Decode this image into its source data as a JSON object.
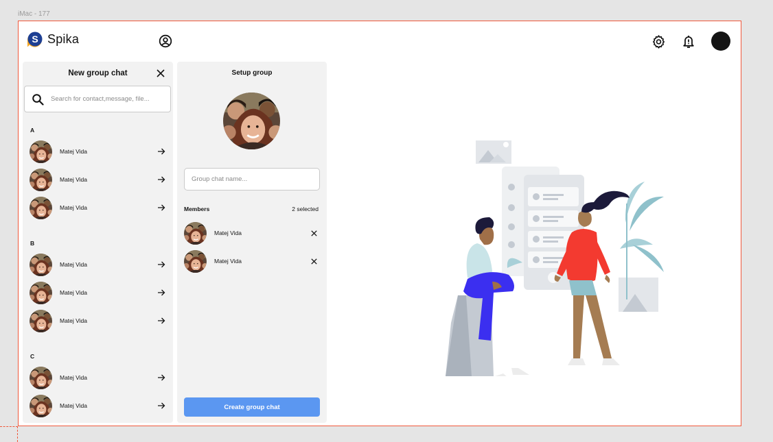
{
  "frame": {
    "label": "iMac - 177"
  },
  "app": {
    "name": "Spika"
  },
  "colors": {
    "accent": "#5b97f1",
    "frame_border": "#f0573a",
    "panel_bg": "#f2f2f2",
    "text": "#141414"
  },
  "icons": [
    "spika-logo-icon",
    "user-circle-icon",
    "gear-icon",
    "bell-alert-icon",
    "close-icon",
    "search-icon",
    "arrow-right-icon"
  ],
  "new_group_panel": {
    "title": "New group chat",
    "search": {
      "placeholder": "Search for contact,message, file...",
      "value": ""
    },
    "sections": [
      {
        "letter": "A",
        "contacts": [
          {
            "name": "Matej Vida"
          },
          {
            "name": "Matej Vida"
          },
          {
            "name": "Matej Vida"
          }
        ]
      },
      {
        "letter": "B",
        "contacts": [
          {
            "name": "Matej Vida"
          },
          {
            "name": "Matej Vida"
          },
          {
            "name": "Matej Vida"
          }
        ]
      },
      {
        "letter": "C",
        "contacts": [
          {
            "name": "Matej Vida"
          },
          {
            "name": "Matej Vida"
          }
        ]
      }
    ]
  },
  "setup_panel": {
    "title": "Setup group",
    "group_name": {
      "placeholder": "Group chat name...",
      "value": ""
    },
    "members_label": "Members",
    "selected_count": "2 selected",
    "members": [
      {
        "name": "Matej Vida"
      },
      {
        "name": "Matej Vida"
      }
    ],
    "create_button": "Create group chat"
  }
}
